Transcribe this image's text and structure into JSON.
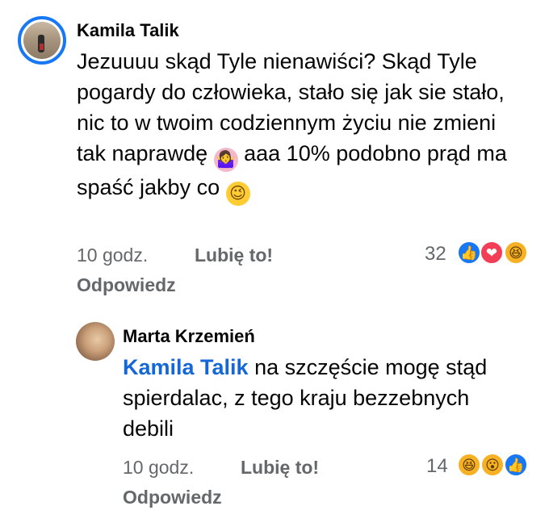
{
  "comments": [
    {
      "author": "Kamila Talik",
      "text_main": "Jezuuuu skąd Tyle nienawiści? Skąd Tyle pogardy do człowieka, stało się jak sie stało, nic to w twoim codziennym życiu nie zmieni tak naprawdę",
      "emoji_1": "🤷‍♀️",
      "text_after": " aaa 10% podobno prąd ma spaść jakby co",
      "emoji_2": "😉",
      "time": "10 godz.",
      "like_label": "Lubię to!",
      "reply_label": "Odpowiedz",
      "reaction_count": "32",
      "reactions": [
        "like-icon",
        "love-icon",
        "haha-icon"
      ]
    },
    {
      "author": "Marta Krzemień",
      "mention": "Kamila Talik",
      "text_main": " na szczęście mogę stąd spierdalac, z tego kraju bezzebnych debili",
      "time": "10 godz.",
      "like_label": "Lubię to!",
      "reply_label": "Odpowiedz",
      "reaction_count": "14",
      "reactions": [
        "haha-icon",
        "wow-icon",
        "like-icon"
      ]
    }
  ],
  "colors": {
    "accent": "#1877f2",
    "mention": "#1467d6",
    "meta": "#65676b",
    "love": "#f33e58",
    "haha": "#f7b125"
  }
}
